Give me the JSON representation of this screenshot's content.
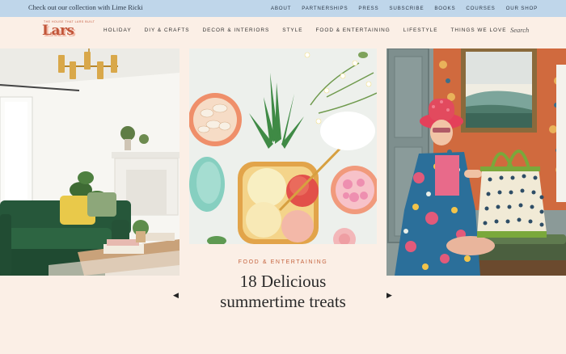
{
  "topbar": {
    "promo": "Check out our collection with Lime Ricki",
    "links": [
      "About",
      "Partnerships",
      "Press",
      "Subscribe",
      "Books",
      "Courses",
      "Our Shop"
    ]
  },
  "brand": {
    "logo": "Lars",
    "tagline": "THE HOUSE THAT LARS BUILT"
  },
  "nav": {
    "items": [
      "Holiday",
      "DIY & Crafts",
      "Decor & Interiors",
      "Style",
      "Food & Entertaining",
      "Lifestyle",
      "Things We Love"
    ]
  },
  "search": {
    "label": "Search"
  },
  "carousel": {
    "kicker": "Food & Entertaining",
    "title_line1": "18 Delicious",
    "title_line2": "summertime treats",
    "prev_glyph": "◀",
    "next_glyph": "▶"
  },
  "colors": {
    "accent": "#c5643f",
    "topbar": "#bfd6ea",
    "page_bg": "#fbefe6",
    "logo": "#c2563a"
  }
}
